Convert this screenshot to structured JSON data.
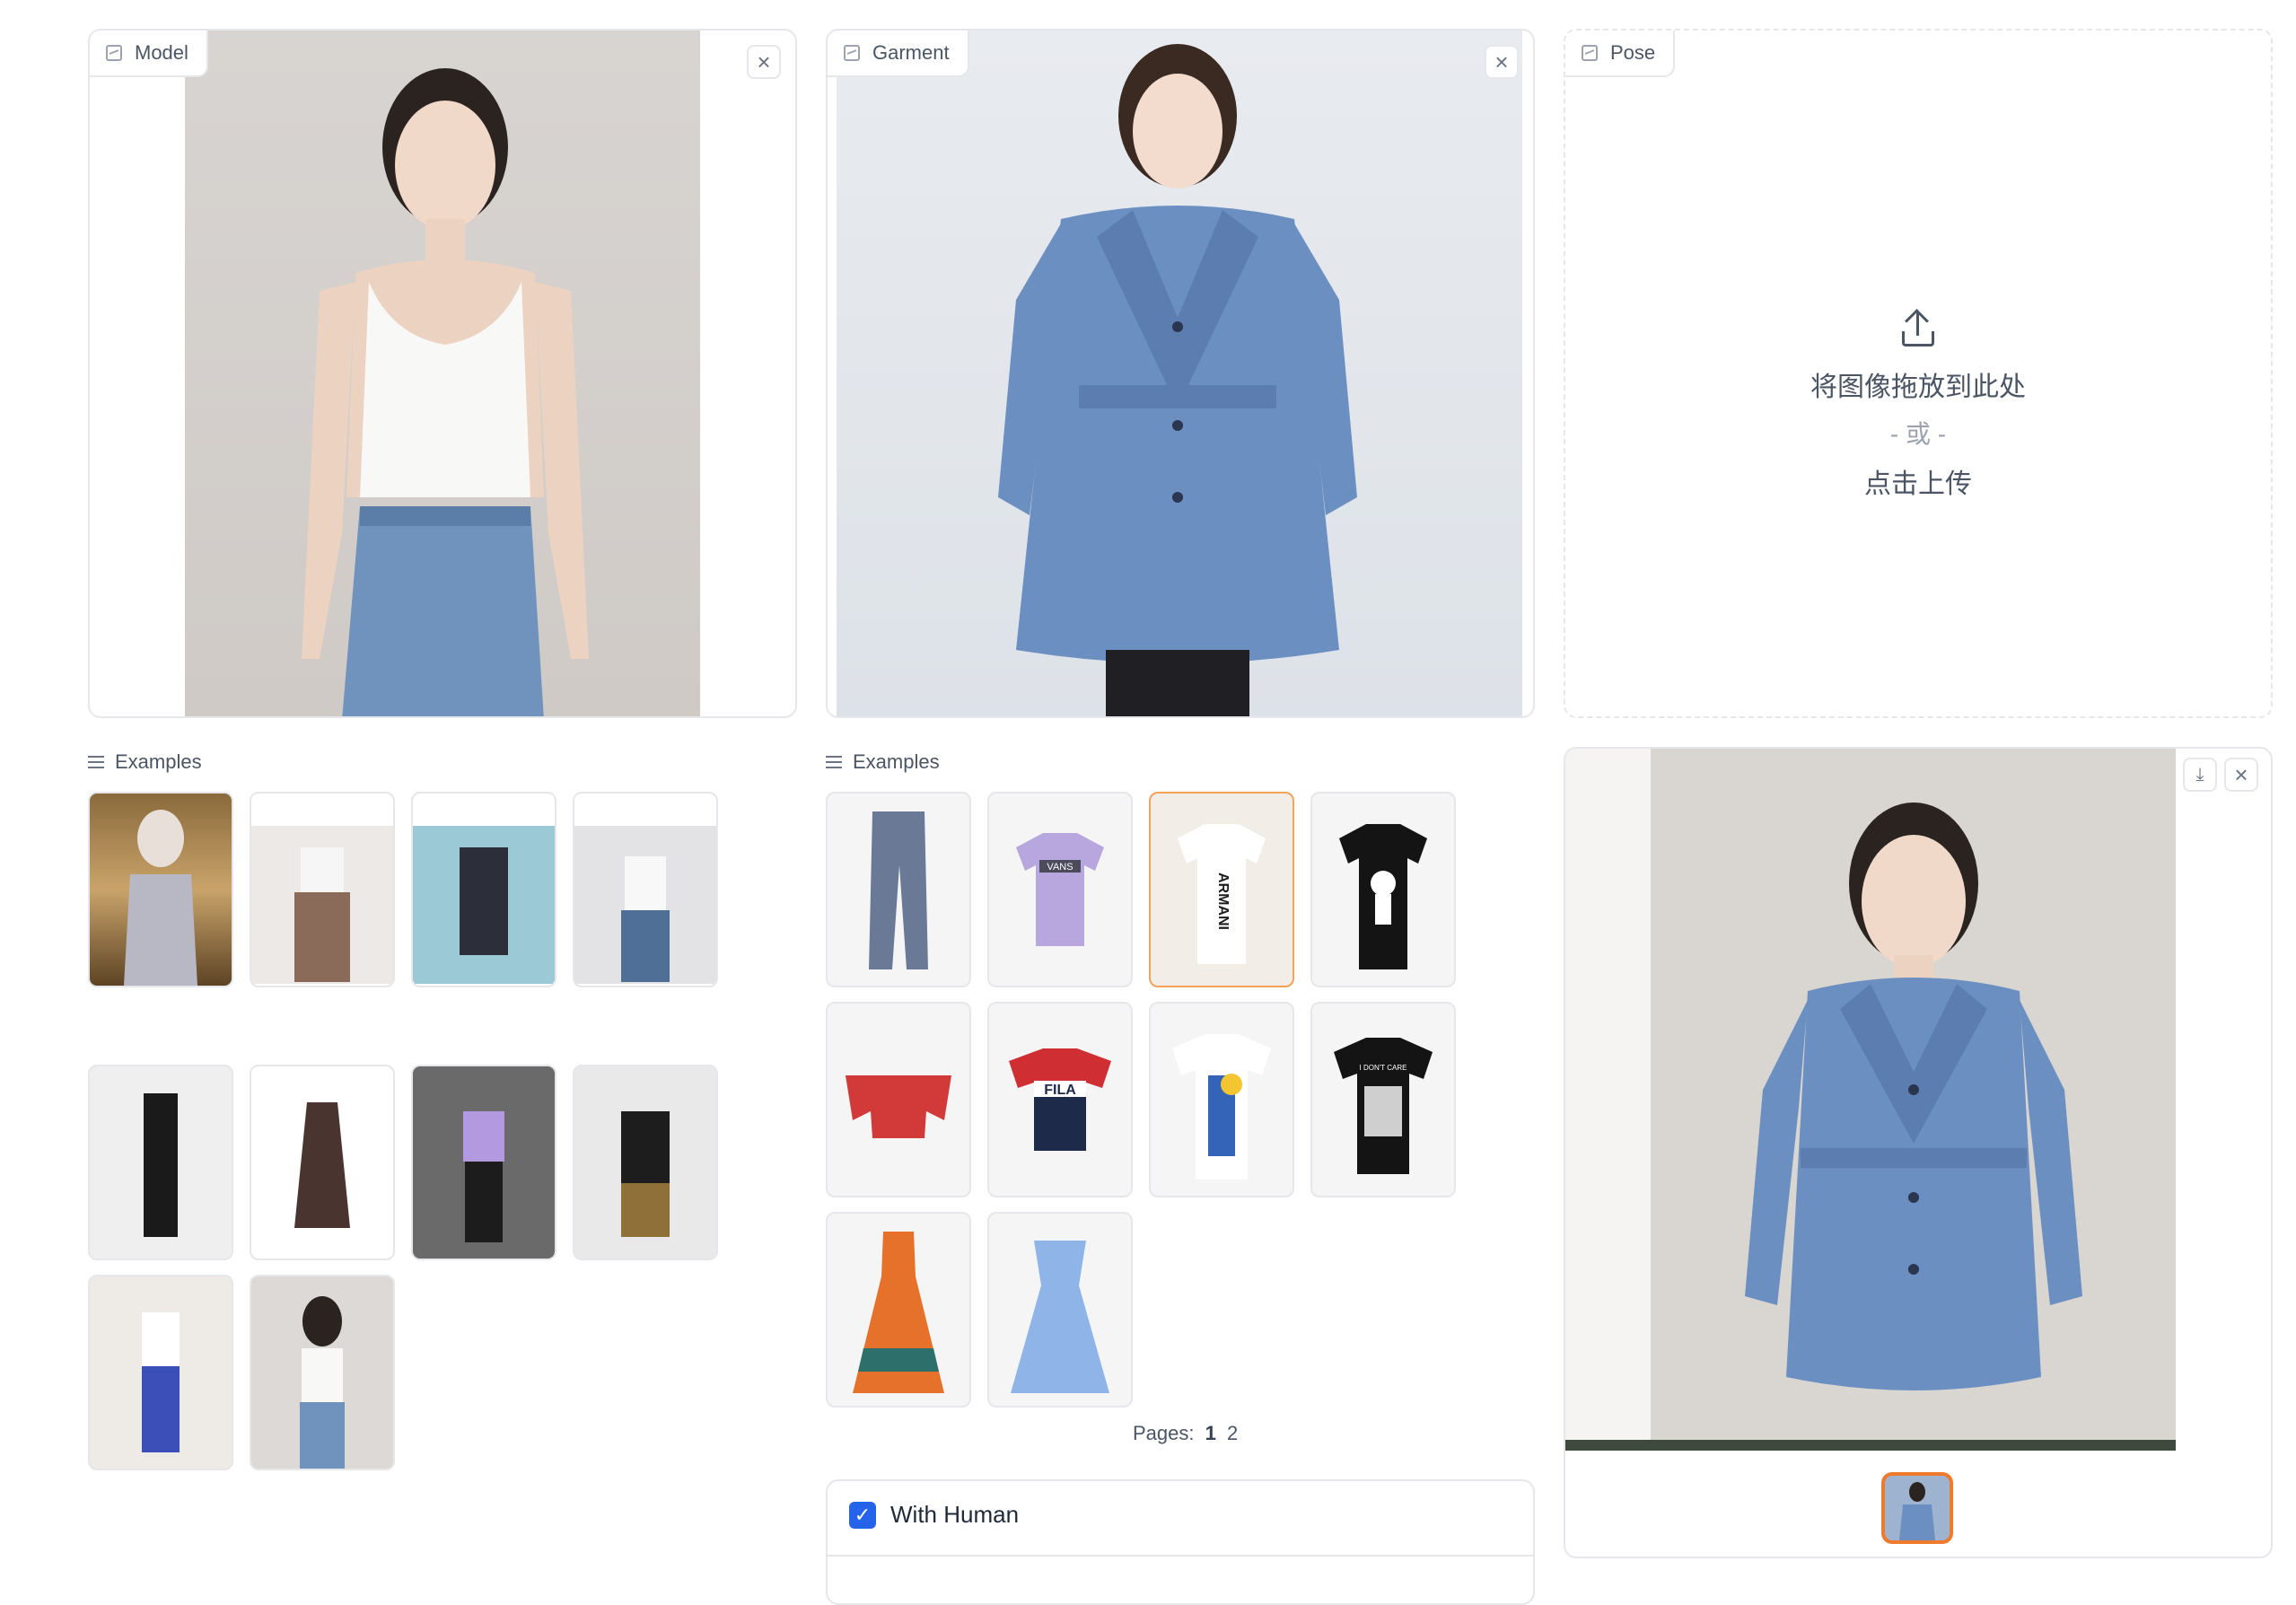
{
  "model_panel": {
    "label": "Model",
    "clear_icon": "close-icon"
  },
  "garment_panel": {
    "label": "Garment",
    "clear_icon": "close-icon"
  },
  "pose_panel": {
    "label": "Pose",
    "drop_text": "将图像拖放到此处",
    "or_text": "- 或 -",
    "click_text": "点击上传",
    "icon": "upload-icon"
  },
  "model_examples": {
    "label": "Examples",
    "count": 10
  },
  "garment_examples": {
    "label": "Examples",
    "items": [
      "VANS",
      "ARMANI",
      "FILA",
      "I DON'T CARE"
    ],
    "pages_label": "Pages:",
    "pages": [
      "1",
      "2"
    ]
  },
  "output_panel": {
    "download_icon": "download-icon",
    "clear_icon": "close-icon"
  },
  "options": {
    "with_human_label": "With Human",
    "with_human_checked": true
  },
  "colors": {
    "accent": "#f5a35b",
    "checkbox": "#2563eb",
    "border": "#e5e7eb",
    "coat_blue": "#6c8fc2"
  }
}
